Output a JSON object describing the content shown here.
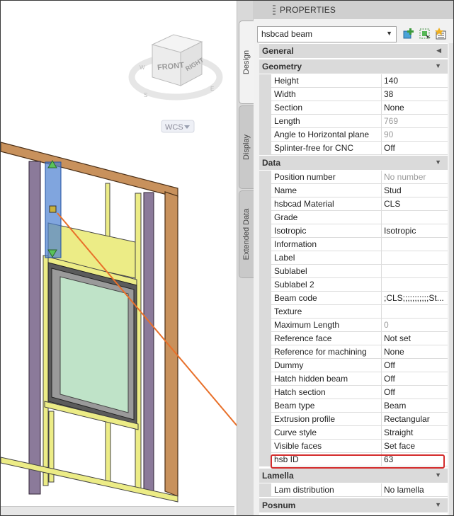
{
  "palette": {
    "title": "PROPERTIES",
    "tabs": [
      {
        "label": "Design",
        "active": true
      },
      {
        "label": "Display",
        "active": false
      },
      {
        "label": "Extended Data",
        "active": false
      }
    ],
    "selector_value": "hsbcad beam",
    "toolbar_icons": [
      "add-to-selection-icon",
      "quick-select-icon",
      "toggle-pickadd-icon"
    ]
  },
  "viewport": {
    "viewcube": {
      "front": "FRONT",
      "right": "RIGHT",
      "compass": [
        "W",
        "S",
        "E"
      ]
    },
    "wcs_label": "WCS"
  },
  "properties": {
    "general": {
      "label": "General",
      "collapsed": true
    },
    "geometry": {
      "label": "Geometry",
      "rows": [
        {
          "name": "Height",
          "value": "140",
          "readonly": false
        },
        {
          "name": "Width",
          "value": "38",
          "readonly": false
        },
        {
          "name": "Section",
          "value": "None",
          "readonly": false
        },
        {
          "name": "Length",
          "value": "769",
          "readonly": true
        },
        {
          "name": "Angle to Horizontal plane",
          "value": "90",
          "readonly": true
        },
        {
          "name": "Splinter-free for CNC",
          "value": "Off",
          "readonly": false
        }
      ]
    },
    "data": {
      "label": "Data",
      "rows": [
        {
          "name": "Position number",
          "value": "No number",
          "readonly": true
        },
        {
          "name": "Name",
          "value": "Stud",
          "readonly": false
        },
        {
          "name": "hsbcad Material",
          "value": "CLS",
          "readonly": false
        },
        {
          "name": "Grade",
          "value": "",
          "readonly": false
        },
        {
          "name": "Isotropic",
          "value": "Isotropic",
          "readonly": false
        },
        {
          "name": "Information",
          "value": "",
          "readonly": false
        },
        {
          "name": "Label",
          "value": "",
          "readonly": false
        },
        {
          "name": "Sublabel",
          "value": "",
          "readonly": false
        },
        {
          "name": "Sublabel 2",
          "value": "",
          "readonly": false
        },
        {
          "name": "Beam code",
          "value": ";CLS;;;;;;;;;;;St...",
          "readonly": false
        },
        {
          "name": "Texture",
          "value": "",
          "readonly": false
        },
        {
          "name": "Maximum Length",
          "value": "0",
          "readonly": true
        },
        {
          "name": "Reference face",
          "value": "Not set",
          "readonly": false
        },
        {
          "name": "Reference for machining",
          "value": "None",
          "readonly": false
        },
        {
          "name": "Dummy",
          "value": "Off",
          "readonly": false
        },
        {
          "name": "Hatch hidden beam",
          "value": "Off",
          "readonly": false
        },
        {
          "name": "Hatch section",
          "value": "Off",
          "readonly": false
        },
        {
          "name": "Beam type",
          "value": "Beam",
          "readonly": false
        },
        {
          "name": "Extrusion profile",
          "value": "Rectangular",
          "readonly": false
        },
        {
          "name": "Curve style",
          "value": "Straight",
          "readonly": false
        },
        {
          "name": "Visible faces",
          "value": "Set face",
          "readonly": false
        },
        {
          "name": "hsb ID",
          "value": "63",
          "readonly": false,
          "highlighted": true
        }
      ]
    },
    "lamella": {
      "label": "Lamella",
      "rows": [
        {
          "name": "Lam distribution",
          "value": "No lamella",
          "readonly": false
        }
      ]
    },
    "posnum": {
      "label": "Posnum"
    }
  },
  "colors": {
    "highlight_border": "#d42c2c",
    "callout_arrow": "#e8702a",
    "selection_blue": "#4a7fd0",
    "timber": "#c8915c",
    "header_yellow": "#ecec86",
    "glass": "#bfe3c8"
  }
}
